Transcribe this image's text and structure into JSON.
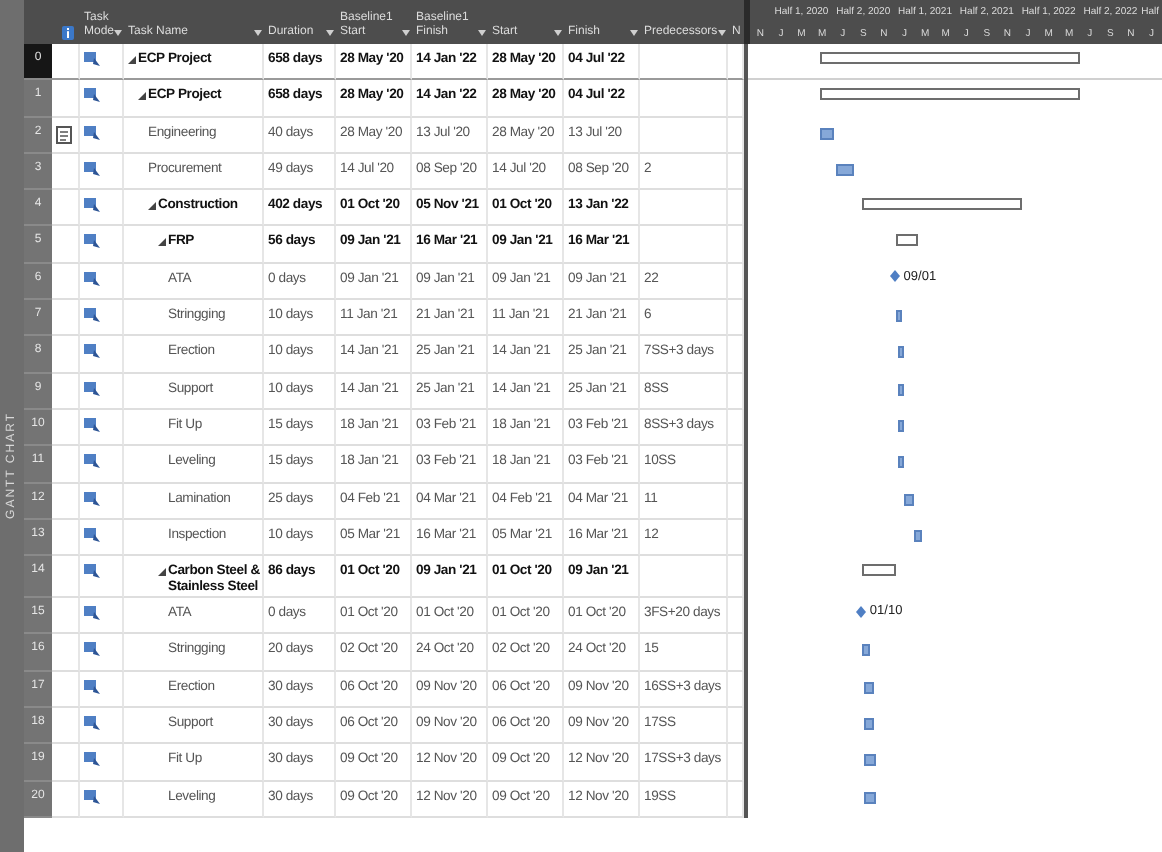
{
  "side_label": "GANTT CHART",
  "columns": [
    "Task Mode",
    "Task Name",
    "Duration",
    "Baseline1 Start",
    "Baseline1 Finish",
    "Start",
    "Finish",
    "Predecessors",
    "N"
  ],
  "timescale": {
    "top": [
      "Half 1, 2020",
      "Half 2, 2020",
      "Half 1, 2021",
      "Half 2, 2021",
      "Half 1, 2022",
      "Half 2, 2022",
      "Half"
    ],
    "bottom": [
      "N",
      "J",
      "M",
      "M",
      "J",
      "S",
      "N",
      "J",
      "M",
      "M",
      "J",
      "S",
      "N",
      "J",
      "M",
      "M",
      "J",
      "S",
      "N",
      "J"
    ]
  },
  "tasks": [
    {
      "id": "0",
      "name": "ECP Project",
      "kind": "summary",
      "selected": true,
      "note": false,
      "duration": "658 days",
      "baseline_start": "28 May '20",
      "baseline_finish": "14 Jan '22",
      "start": "28 May '20",
      "finish": "04 Jul '22",
      "children": [
        {
          "id": "1",
          "name": "ECP Project",
          "kind": "summary",
          "selected": false,
          "note": false,
          "duration": "658 days",
          "baseline_start": "28 May '20",
          "baseline_finish": "14 Jan '22",
          "start": "28 May '20",
          "finish": "04 Jul '22",
          "children": [
            {
              "id": "2",
              "name": "Engineering",
              "kind": "task",
              "selected": false,
              "note": true,
              "duration": "40 days",
              "baseline_start": "28 May '20",
              "baseline_finish": "13 Jul '20",
              "start": "28 May '20",
              "finish": "13 Jul '20"
            },
            {
              "id": "3",
              "name": "Procurement",
              "kind": "task",
              "selected": false,
              "note": false,
              "duration": "49 days",
              "baseline_start": "14 Jul '20",
              "baseline_finish": "08 Sep '20",
              "start": "14 Jul '20",
              "finish": "08 Sep '20",
              "predecessors": "2"
            },
            {
              "id": "4",
              "name": "Construction",
              "kind": "summary",
              "selected": false,
              "note": false,
              "duration": "402 days",
              "baseline_start": "01 Oct '20",
              "baseline_finish": "05 Nov '21",
              "start": "01 Oct '20",
              "finish": "13 Jan '22",
              "children": [
                {
                  "id": "5",
                  "name": "FRP",
                  "kind": "summary",
                  "selected": false,
                  "note": false,
                  "duration": "56 days",
                  "baseline_start": "09 Jan '21",
                  "baseline_finish": "16 Mar '21",
                  "start": "09 Jan '21",
                  "finish": "16 Mar '21",
                  "children": [
                    {
                      "id": "6",
                      "name": "ATA",
                      "kind": "milestone",
                      "selected": false,
                      "note": false,
                      "duration": "0 days",
                      "baseline_start": "09 Jan '21",
                      "baseline_finish": "09 Jan '21",
                      "start": "09 Jan '21",
                      "finish": "09 Jan '21",
                      "predecessors": "22",
                      "label": "09/01"
                    },
                    {
                      "id": "7",
                      "name": "Stringging",
                      "kind": "task",
                      "selected": false,
                      "note": false,
                      "duration": "10 days",
                      "baseline_start": "11 Jan '21",
                      "baseline_finish": "21 Jan '21",
                      "start": "11 Jan '21",
                      "finish": "21 Jan '21",
                      "predecessors": "6"
                    },
                    {
                      "id": "8",
                      "name": "Erection",
                      "kind": "task",
                      "selected": false,
                      "note": false,
                      "duration": "10 days",
                      "baseline_start": "14 Jan '21",
                      "baseline_finish": "25 Jan '21",
                      "start": "14 Jan '21",
                      "finish": "25 Jan '21",
                      "predecessors": "7SS+3 days"
                    },
                    {
                      "id": "9",
                      "name": "Support",
                      "kind": "task",
                      "selected": false,
                      "note": false,
                      "duration": "10 days",
                      "baseline_start": "14 Jan '21",
                      "baseline_finish": "25 Jan '21",
                      "start": "14 Jan '21",
                      "finish": "25 Jan '21",
                      "predecessors": "8SS"
                    },
                    {
                      "id": "10",
                      "name": "Fit Up",
                      "kind": "task",
                      "selected": false,
                      "note": false,
                      "duration": "15 days",
                      "baseline_start": "18 Jan '21",
                      "baseline_finish": "03 Feb '21",
                      "start": "18 Jan '21",
                      "finish": "03 Feb '21",
                      "predecessors": "8SS+3 days"
                    },
                    {
                      "id": "11",
                      "name": "Leveling",
                      "kind": "task",
                      "selected": false,
                      "note": false,
                      "duration": "15 days",
                      "baseline_start": "18 Jan '21",
                      "baseline_finish": "03 Feb '21",
                      "start": "18 Jan '21",
                      "finish": "03 Feb '21",
                      "predecessors": "10SS"
                    },
                    {
                      "id": "12",
                      "name": "Lamination",
                      "kind": "task",
                      "selected": false,
                      "note": false,
                      "duration": "25 days",
                      "baseline_start": "04 Feb '21",
                      "baseline_finish": "04 Mar '21",
                      "start": "04 Feb '21",
                      "finish": "04 Mar '21",
                      "predecessors": "11"
                    },
                    {
                      "id": "13",
                      "name": "Inspection",
                      "kind": "task",
                      "selected": false,
                      "note": false,
                      "duration": "10 days",
                      "baseline_start": "05 Mar '21",
                      "baseline_finish": "16 Mar '21",
                      "start": "05 Mar '21",
                      "finish": "16 Mar '21",
                      "predecessors": "12"
                    }
                  ]
                },
                {
                  "id": "14",
                  "name": "Carbon Steel & Stainless Steel",
                  "kind": "summary",
                  "selected": false,
                  "note": false,
                  "duration": "86 days",
                  "baseline_start": "01 Oct '20",
                  "baseline_finish": "09 Jan '21",
                  "start": "01 Oct '20",
                  "finish": "09 Jan '21",
                  "children": [
                    {
                      "id": "15",
                      "name": "ATA",
                      "kind": "milestone",
                      "selected": false,
                      "note": false,
                      "duration": "0 days",
                      "baseline_start": "01 Oct '20",
                      "baseline_finish": "01 Oct '20",
                      "start": "01 Oct '20",
                      "finish": "01 Oct '20",
                      "predecessors": "3FS+20 days",
                      "label": "01/10"
                    },
                    {
                      "id": "16",
                      "name": "Stringging",
                      "kind": "task",
                      "selected": false,
                      "note": false,
                      "duration": "20 days",
                      "baseline_start": "02 Oct '20",
                      "baseline_finish": "24 Oct '20",
                      "start": "02 Oct '20",
                      "finish": "24 Oct '20",
                      "predecessors": "15"
                    },
                    {
                      "id": "17",
                      "name": "Erection",
                      "kind": "task",
                      "selected": false,
                      "note": false,
                      "duration": "30 days",
                      "baseline_start": "06 Oct '20",
                      "baseline_finish": "09 Nov '20",
                      "start": "06 Oct '20",
                      "finish": "09 Nov '20",
                      "predecessors": "16SS+3 days"
                    },
                    {
                      "id": "18",
                      "name": "Support",
                      "kind": "task",
                      "selected": false,
                      "note": false,
                      "duration": "30 days",
                      "baseline_start": "06 Oct '20",
                      "baseline_finish": "09 Nov '20",
                      "start": "06 Oct '20",
                      "finish": "09 Nov '20",
                      "predecessors": "17SS"
                    },
                    {
                      "id": "19",
                      "name": "Fit Up",
                      "kind": "task",
                      "selected": false,
                      "note": false,
                      "duration": "30 days",
                      "baseline_start": "09 Oct '20",
                      "baseline_finish": "12 Nov '20",
                      "start": "09 Oct '20",
                      "finish": "12 Nov '20",
                      "predecessors": "17SS+3 days"
                    },
                    {
                      "id": "20",
                      "name": "Leveling",
                      "kind": "task",
                      "selected": false,
                      "note": false,
                      "duration": "30 days",
                      "baseline_start": "09 Oct '20",
                      "baseline_finish": "12 Nov '20",
                      "start": "09 Oct '20",
                      "finish": "12 Nov '20",
                      "predecessors": "19SS"
                    }
                  ]
                }
              ]
            }
          ]
        }
      ]
    }
  ]
}
